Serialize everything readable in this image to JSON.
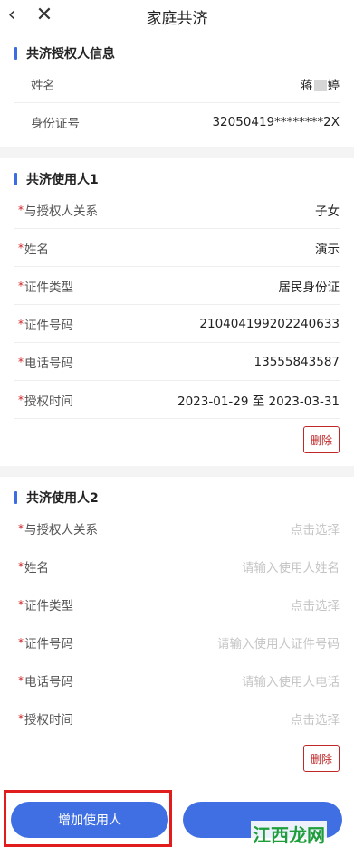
{
  "header": {
    "title": "家庭共济",
    "back_icon": "chevron-left",
    "close_icon": "close-x"
  },
  "grantor": {
    "title": "共济授权人信息",
    "rows": [
      {
        "label": "姓名",
        "value_pre": "蒋",
        "value_post": "婷"
      },
      {
        "label": "身份证号",
        "value": "32050419********2X"
      }
    ]
  },
  "user1": {
    "title": "共济使用人1",
    "rows": [
      {
        "label": "与授权人关系",
        "value": "子女"
      },
      {
        "label": "姓名",
        "value": "演示"
      },
      {
        "label": "证件类型",
        "value": "居民身份证"
      },
      {
        "label": "证件号码",
        "value": "210404199202240633"
      },
      {
        "label": "电话号码",
        "value": "13555843587"
      },
      {
        "label": "授权时间",
        "value": "2023-01-29 至 2023-03-31"
      }
    ],
    "delete_label": "删除"
  },
  "user2": {
    "title": "共济使用人2",
    "rows": [
      {
        "label": "与授权人关系",
        "placeholder": "点击选择"
      },
      {
        "label": "姓名",
        "placeholder": "请输入使用人姓名"
      },
      {
        "label": "证件类型",
        "placeholder": "点击选择"
      },
      {
        "label": "证件号码",
        "placeholder": "请输入使用人证件号码"
      },
      {
        "label": "电话号码",
        "placeholder": "请输入使用人电话"
      },
      {
        "label": "授权时间",
        "placeholder": "点击选择"
      }
    ],
    "delete_label": "删除"
  },
  "required_mark": "*",
  "footer": {
    "add_label": "增加使用人",
    "submit_label": ""
  },
  "watermark": "江西龙网",
  "colors": {
    "accent": "#3f6fe2",
    "danger": "#c02828",
    "highlight": "#e11c1c"
  }
}
